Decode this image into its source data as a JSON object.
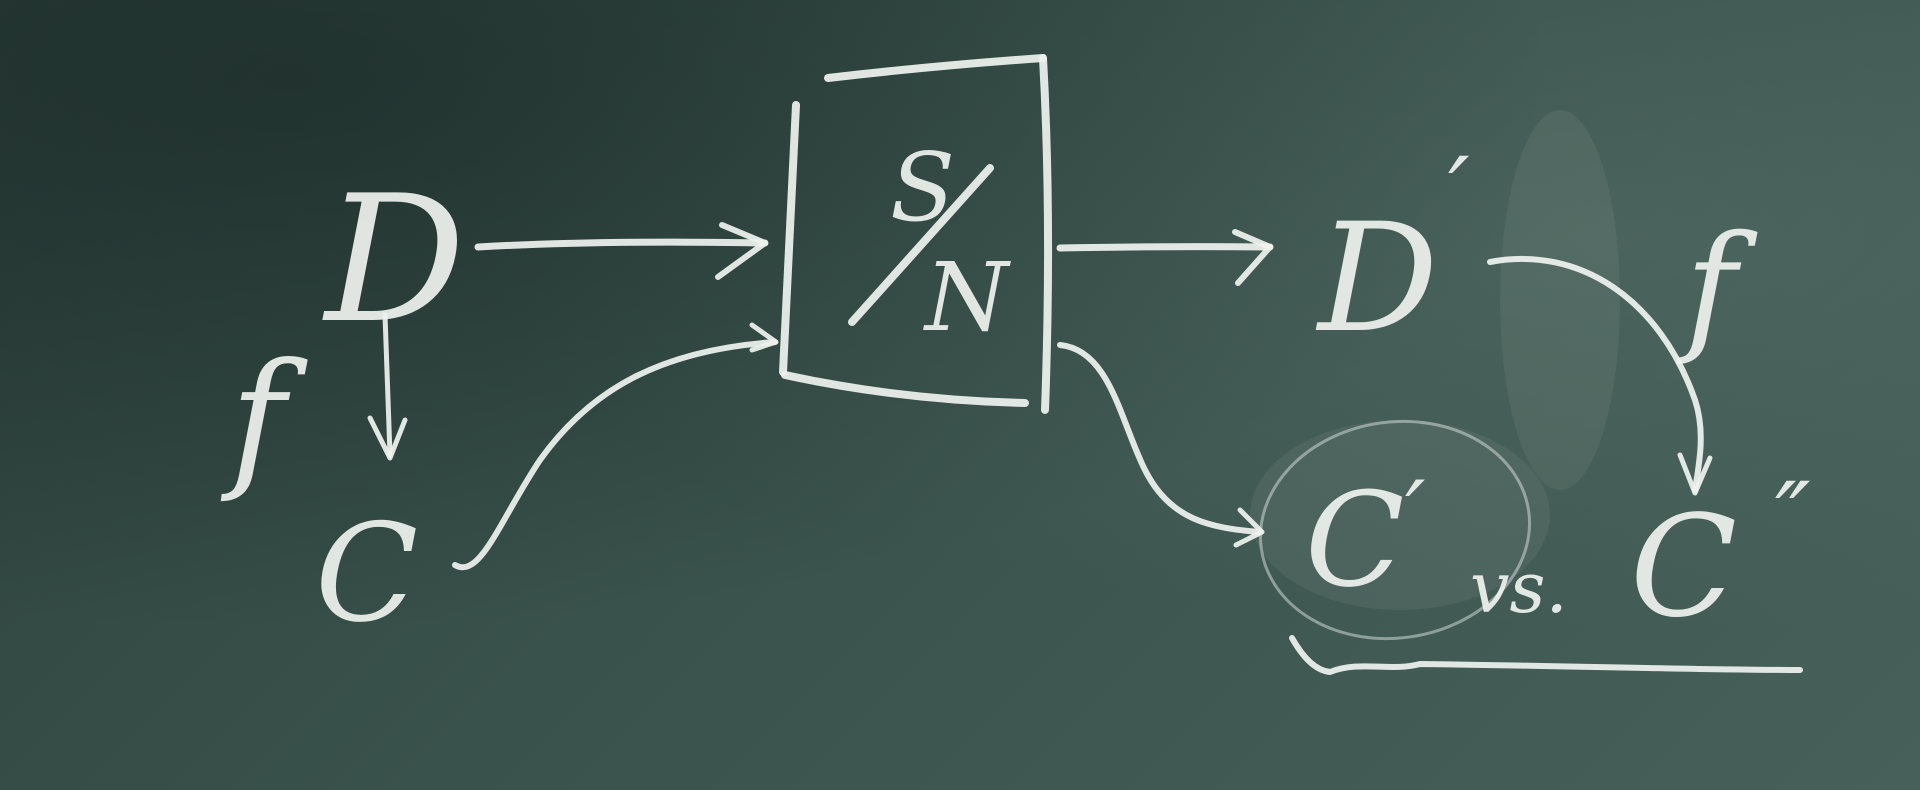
{
  "diagram": {
    "input_d": "D",
    "input_c": "C",
    "mapping_left": "f",
    "box_top": "S",
    "box_bottom": "N",
    "output_d": "D",
    "output_d_prime": "′",
    "output_c": "C",
    "output_c_prime": "′",
    "versus": "vs.",
    "output_c_double": "C",
    "output_c_double_prime": "″",
    "mapping_right": "f"
  }
}
